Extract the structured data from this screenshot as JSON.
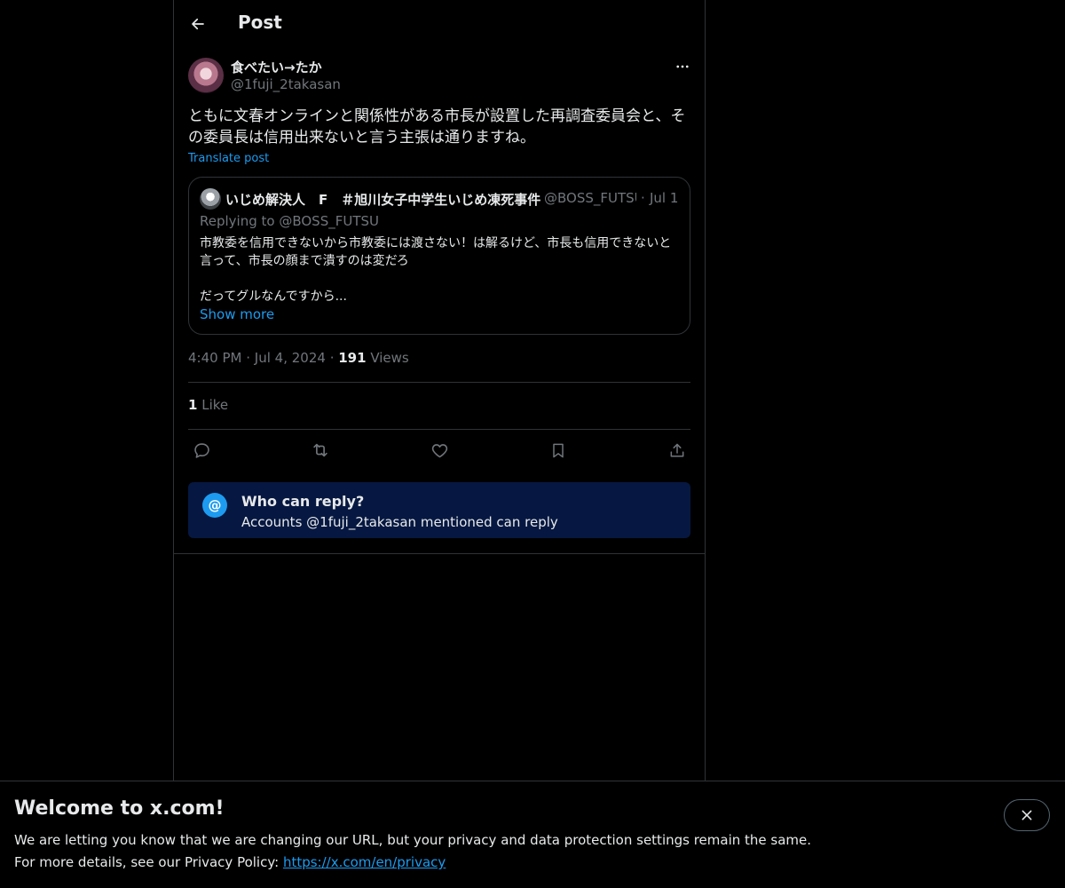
{
  "header": {
    "title": "Post"
  },
  "post": {
    "display_name": "食べたい→たか",
    "handle": "@1fuji_2takasan",
    "text": "ともに文春オンラインと関係性がある市長が設置した再調査委員会と、その委員長は信用出来ないと言う主張は通りますね。",
    "translate_label": "Translate post",
    "time": "4:40 PM",
    "date": "Jul 4, 2024",
    "views_count": "191",
    "views_label": "Views",
    "likes_count": "1",
    "likes_label": "Like"
  },
  "quote": {
    "display_name": "いじめ解決人　F　＃旭川女子中学生いじめ凍死事件",
    "handle": "@BOSS_FUTSU",
    "date": "Jul 1",
    "replying_to": "Replying to @BOSS_FUTSU",
    "text_line1": "市教委を信用できないから市教委には渡さない！は解るけど、市長も信用できないと言って、市長の顔まで潰すのは変だろ",
    "text_line2": "だってグルなんですから...",
    "show_more": "Show more"
  },
  "who_can_reply": {
    "title": "Who can reply?",
    "subtitle": "Accounts @1fuji_2takasan mentioned can reply"
  },
  "banner": {
    "title": "Welcome to x.com!",
    "line1": "We are letting you know that we are changing our URL, but your privacy and data protection settings remain the same.",
    "line2_prefix": "For more details, see our Privacy Policy: ",
    "link": "https://x.com/en/privacy"
  },
  "icons": {
    "back": "arrow-left-icon",
    "more": "more-horizontal-icon",
    "reply": "reply-icon",
    "repost": "repost-icon",
    "like": "heart-icon",
    "bookmark": "bookmark-icon",
    "share": "share-icon",
    "close": "close-icon"
  },
  "colors": {
    "background": "#000000",
    "text": "#e7e9ea",
    "muted": "#71767b",
    "accent": "#1d9bf0",
    "border": "#2f3336",
    "reply_box_bg": "#061841"
  }
}
